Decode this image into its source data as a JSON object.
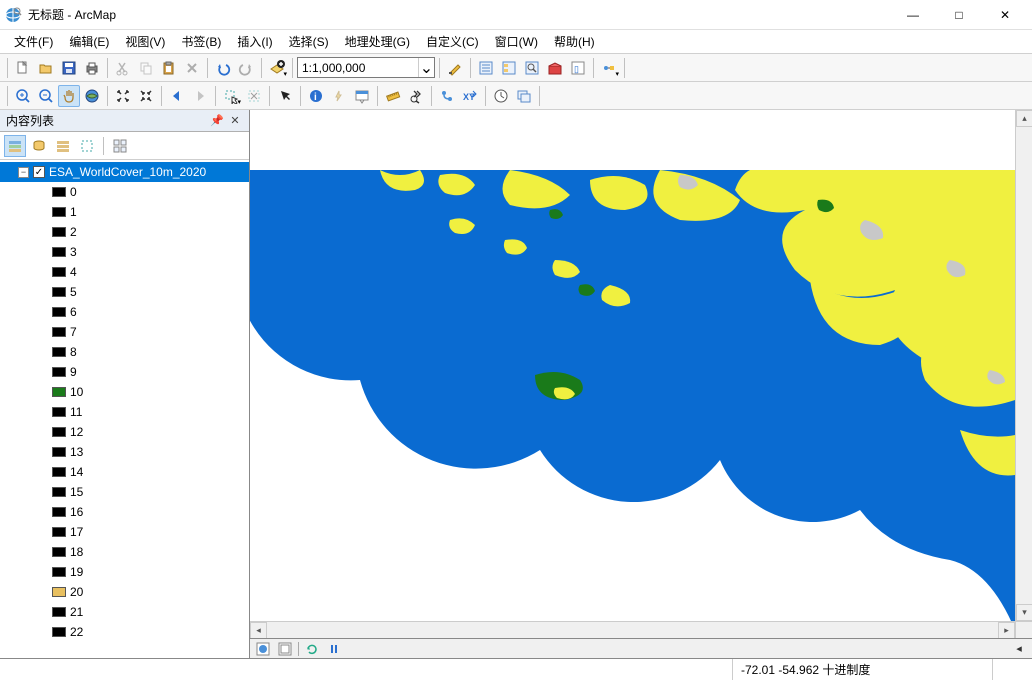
{
  "window": {
    "title": "无标题 - ArcMap",
    "minimize": "—",
    "maximize": "□",
    "close": "✕"
  },
  "menu": {
    "file": "文件(F)",
    "edit": "编辑(E)",
    "view": "视图(V)",
    "bookmarks": "书签(B)",
    "insert": "插入(I)",
    "selection": "选择(S)",
    "geoprocessing": "地理处理(G)",
    "customize": "自定义(C)",
    "windows": "窗口(W)",
    "help": "帮助(H)"
  },
  "toolbar1": {
    "scale": "1:1,000,000"
  },
  "toc": {
    "title": "内容列表",
    "layer_name": "ESA_WorldCover_10m_2020",
    "legend": [
      {
        "label": "0",
        "color": "#000000"
      },
      {
        "label": "1",
        "color": "#000000"
      },
      {
        "label": "2",
        "color": "#000000"
      },
      {
        "label": "3",
        "color": "#000000"
      },
      {
        "label": "4",
        "color": "#000000"
      },
      {
        "label": "5",
        "color": "#000000"
      },
      {
        "label": "6",
        "color": "#000000"
      },
      {
        "label": "7",
        "color": "#000000"
      },
      {
        "label": "8",
        "color": "#000000"
      },
      {
        "label": "9",
        "color": "#000000"
      },
      {
        "label": "10",
        "color": "#1a7a1a"
      },
      {
        "label": "11",
        "color": "#000000"
      },
      {
        "label": "12",
        "color": "#000000"
      },
      {
        "label": "13",
        "color": "#000000"
      },
      {
        "label": "14",
        "color": "#000000"
      },
      {
        "label": "15",
        "color": "#000000"
      },
      {
        "label": "16",
        "color": "#000000"
      },
      {
        "label": "17",
        "color": "#000000"
      },
      {
        "label": "18",
        "color": "#000000"
      },
      {
        "label": "19",
        "color": "#000000"
      },
      {
        "label": "20",
        "color": "#e8c060"
      },
      {
        "label": "21",
        "color": "#000000"
      },
      {
        "label": "22",
        "color": "#000000"
      }
    ]
  },
  "status": {
    "coords": "-72.01  -54.962 十进制度"
  },
  "colors": {
    "selection": "#0078d7",
    "water": "#0a6bd1",
    "veg_yellow": "#f0f040",
    "veg_green": "#1a7a1a",
    "gray": "#c8c8c8"
  }
}
